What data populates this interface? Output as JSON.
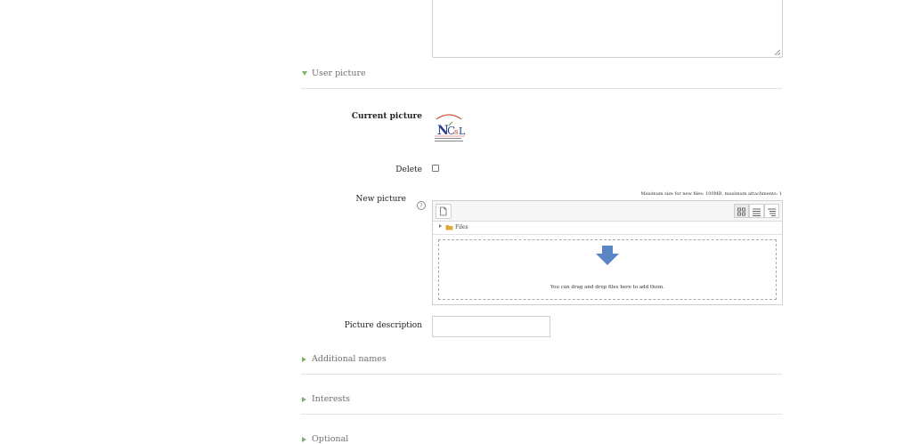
{
  "sections": {
    "user_picture": "User picture",
    "additional_names": "Additional names",
    "interests": "Interests",
    "optional": "Optional"
  },
  "fields": {
    "current_picture": "Current picture",
    "delete": "Delete",
    "new_picture": "New picture",
    "picture_description": "Picture description"
  },
  "help_icon_glyph": "?",
  "filepicker": {
    "max_size_text": "Maximum size for new files: 100MB, maximum attachments: 1",
    "path_label": "Files",
    "drop_text": "You can drag and drop files here to add them."
  },
  "logo": {
    "arc_text": "TRAINING FOR BUSINESS",
    "letters": "NCsL",
    "tag1": "Every Child Learn",
    "tag2": "Every School Grow"
  },
  "colors": {
    "accent_caret": "#7cb26b",
    "drop_arrow": "#5b86c6",
    "folder": "#e1a93a"
  },
  "icons": {
    "add_file": "add-file-icon",
    "grid_view": "grid-view-icon",
    "list_view": "list-view-icon",
    "tree_view": "tree-view-icon",
    "folder": "folder-icon",
    "drop_arrow": "down-arrow-icon"
  }
}
